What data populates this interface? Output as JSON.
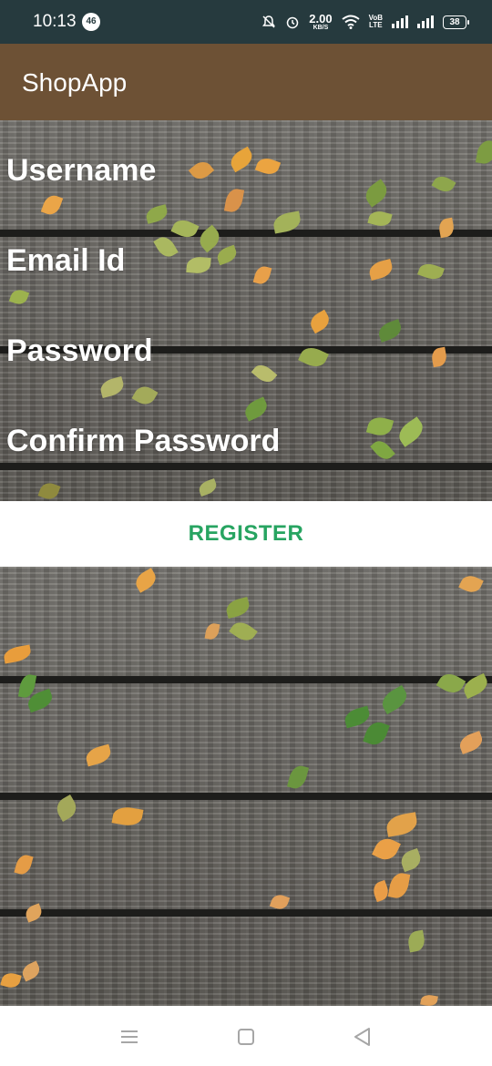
{
  "status_bar": {
    "time": "10:13",
    "notification_count": "46",
    "net_speed_value": "2.00",
    "net_speed_unit": "KB/S",
    "volte_line1": "VoB",
    "volte_line2": "LTE",
    "battery": "38"
  },
  "app_bar": {
    "title": "ShopApp",
    "color": "#6d5135"
  },
  "form": {
    "username_label": "Username",
    "email_label": "Email Id",
    "password_label": "Password",
    "confirm_password_label": "Confirm Password",
    "register_label": "REGISTER",
    "register_color": "#27a461"
  },
  "nav_bar": {
    "icons": [
      "menu-icon",
      "home-icon",
      "back-icon"
    ]
  }
}
